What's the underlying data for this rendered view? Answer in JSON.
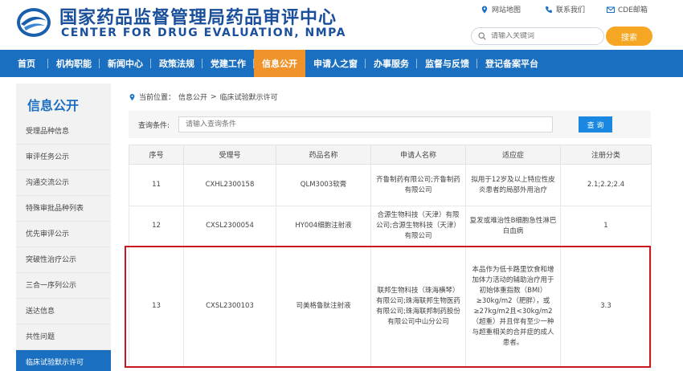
{
  "header": {
    "title_cn": "国家药品监督管理局药品审评中心",
    "title_en": "CENTER FOR DRUG EVALUATION, NMPA",
    "util_links": [
      "网站地图",
      "联系我们",
      "CDE邮箱"
    ],
    "search_placeholder": "请输入关键词",
    "search_button": "搜索"
  },
  "nav": {
    "items": [
      "首页",
      "机构职能",
      "新闻中心",
      "政策法规",
      "党建工作",
      "信息公开",
      "申请人之窗",
      "办事服务",
      "监督与反馈",
      "登记备案平台"
    ],
    "active": "信息公开"
  },
  "sidebar": {
    "title": "信息公开",
    "items": [
      "受理品种信息",
      "审评任务公示",
      "沟通交流公示",
      "特殊审批品种列表",
      "优先审评公示",
      "突破性治疗公示",
      "三合一序列公示",
      "送达信息",
      "共性问题",
      "临床试验默示许可"
    ],
    "active": "临床试验默示许可"
  },
  "breadcrumb": {
    "label": "当前位置：",
    "items": [
      "信息公开",
      ">",
      "临床试验默示许可"
    ]
  },
  "filter": {
    "label": "查询条件:",
    "placeholder": "请输入查询条件",
    "button": "查 询"
  },
  "table": {
    "headers": [
      "序号",
      "受理号",
      "药品名称",
      "申请人名称",
      "适应症",
      "注册分类"
    ],
    "rows": [
      [
        "11",
        "CXHL2300158",
        "QLM3003软膏",
        "齐鲁制药有限公司;齐鲁制药有限公司",
        "拟用于12岁及以上特应性皮炎患者的局部外用治疗",
        "2.1;2.2;2.4"
      ],
      [
        "12",
        "CXSL2300054",
        "HY004细胞注射液",
        "合源生物科技（天津）有限公司;合源生物科技（天津）有限公司",
        "复发或难治性B细胞急性淋巴白血病",
        "1"
      ],
      [
        "13",
        "CXSL2300103",
        "司美格鲁肽注射液",
        "联邦生物科技（珠海横琴）有限公司;珠海联邦生物医药有限公司;珠海联邦制药股份有限公司中山分公司",
        "本品作为低卡路里饮食和增加体力活动的辅助治疗用于初始体重指数（BMI）≥30kg/m2（肥胖），或≥27kg/m2且<30kg/m2（超重）并且伴有至少一种与超重相关的合并症的成人患者。",
        "3.3"
      ]
    ]
  },
  "colors": {
    "brand_blue": "#1a6fc0",
    "accent_orange": "#f0932b",
    "highlight_red": "#c8191e"
  }
}
